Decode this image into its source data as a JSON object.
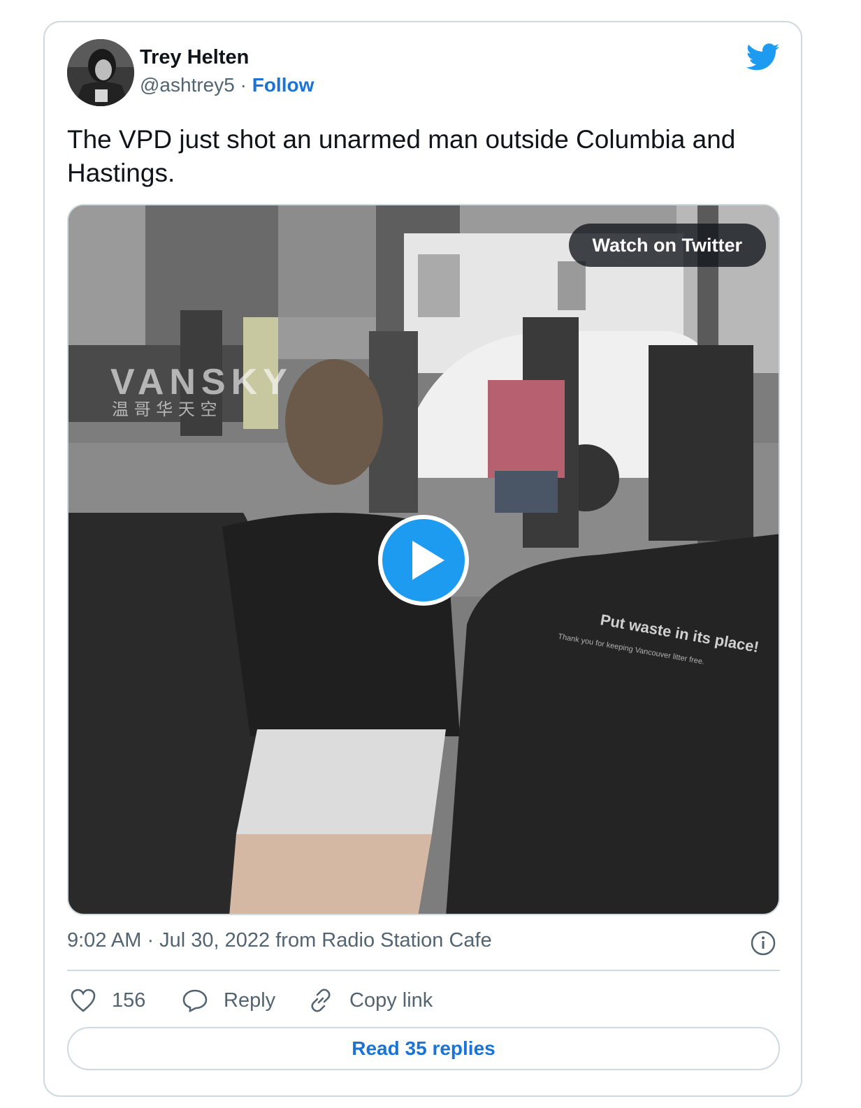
{
  "author": {
    "name": "Trey Helten",
    "handle": "@ashtrey5",
    "separator": "·",
    "follow_label": "Follow"
  },
  "tweet": {
    "text": "The VPD just shot an unarmed man outside Columbia and Hastings."
  },
  "media": {
    "watch_label": "Watch on Twitter",
    "watermark_text": "VANSKY",
    "watermark_sub": "温 哥 华 天 空",
    "bin_line1": "Put waste in its place!",
    "bin_line2": "Thank you for keeping Vancouver litter free."
  },
  "meta": {
    "timestamp": "9:02 AM · Jul 30, 2022 from Radio Station Cafe"
  },
  "actions": {
    "likes": "156",
    "reply_label": "Reply",
    "copy_label": "Copy link"
  },
  "read_replies_label": "Read 35 replies",
  "colors": {
    "accent": "#1d9bf0",
    "link": "#1a73d6",
    "muted": "#536471",
    "border": "#cfd9de"
  },
  "icons": [
    "twitter-bird-icon",
    "play-icon",
    "info-icon",
    "heart-icon",
    "reply-icon",
    "link-icon"
  ]
}
